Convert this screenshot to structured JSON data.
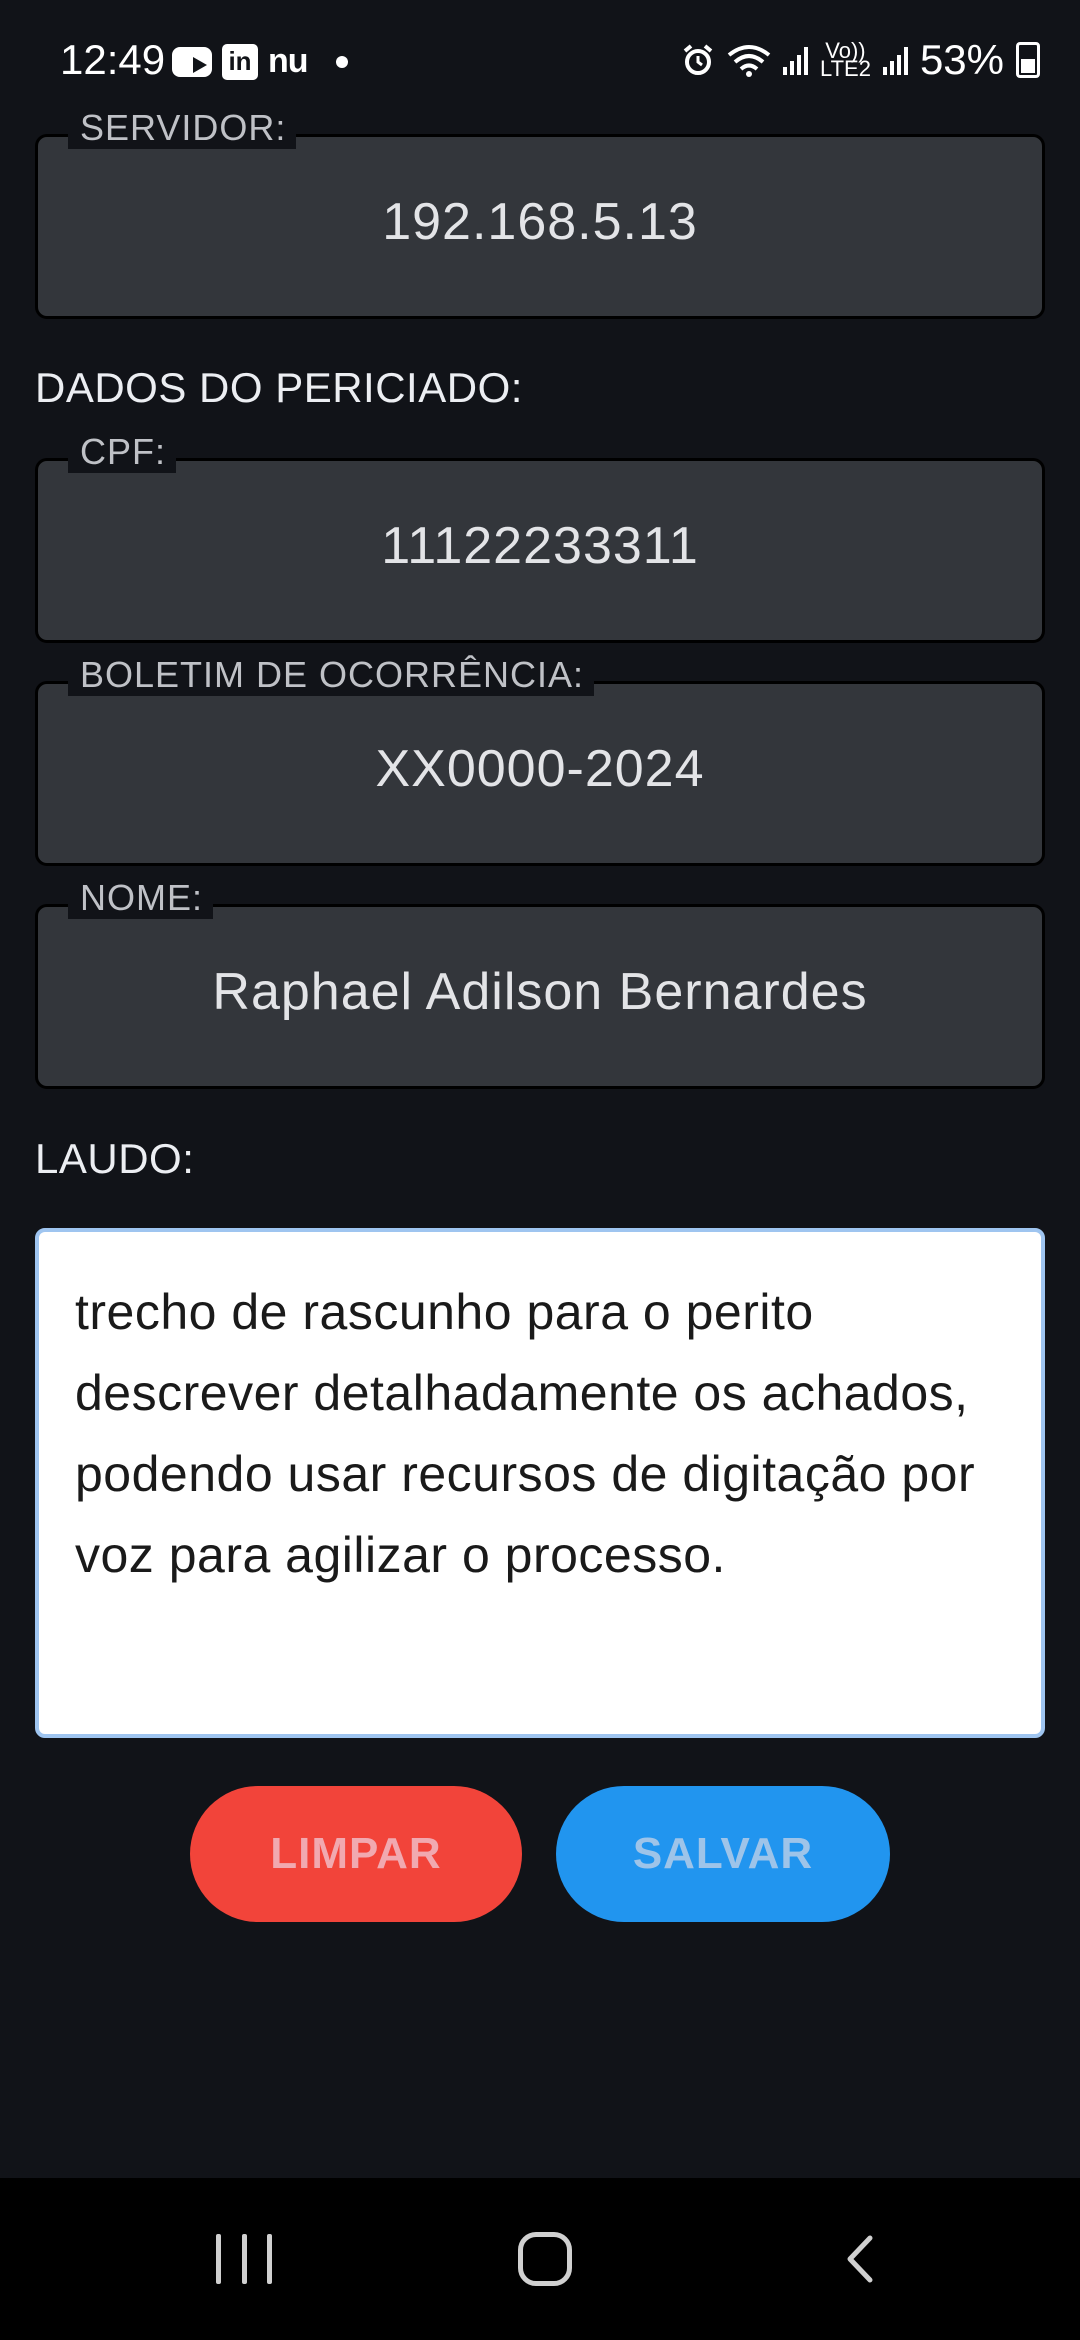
{
  "status_bar": {
    "time": "12:49",
    "notif_icons": [
      "youtube-icon",
      "linkedin-icon",
      "nubank-icon",
      "dot-icon"
    ],
    "linkedin_text": "in",
    "nubank_text": "nu",
    "net_label_top": "Vo))",
    "net_label_bottom": "LTE2",
    "battery": "53%"
  },
  "servidor": {
    "label": "SERVIDOR:",
    "value": "192.168.5.13"
  },
  "section_periciado": "DADOS DO PERICIADO:",
  "cpf": {
    "label": "CPF:",
    "value": "11122233311"
  },
  "boletim": {
    "label": "BOLETIM DE OCORRÊNCIA:",
    "value": "XX0000-2024"
  },
  "nome": {
    "label": "NOME:",
    "value": "Raphael Adilson Bernardes"
  },
  "section_laudo": "LAUDO:",
  "laudo_text": "trecho de rascunho para o perito descrever detalhadamente os achados, podendo usar recursos de digitação por voz para agilizar o processo.",
  "buttons": {
    "clear": "LIMPAR",
    "save": "SALVAR"
  },
  "colors": {
    "background": "#111318",
    "field_bg": "#33363b",
    "clear_button": "#f2443a",
    "save_button": "#2195ef",
    "textarea_border": "#9fc5f0"
  }
}
